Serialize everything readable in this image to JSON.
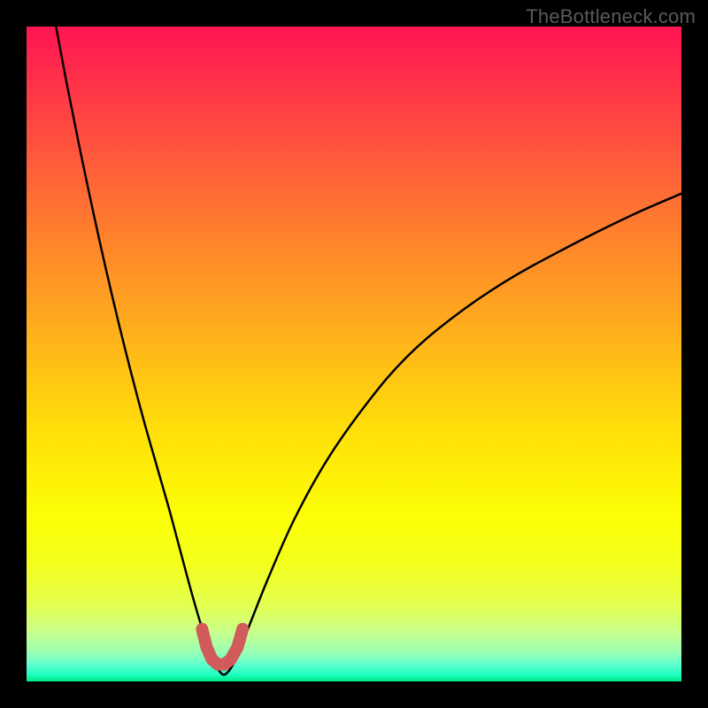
{
  "watermark": "TheBottleneck.com",
  "colors": {
    "page_bg": "#000000",
    "curve_stroke": "#000000",
    "marker_stroke": "#d15a5a"
  },
  "chart_data": {
    "type": "line",
    "title": "",
    "xlabel": "",
    "ylabel": "",
    "xlim": [
      0,
      100
    ],
    "ylim": [
      0,
      100
    ],
    "background_gradient": {
      "direction": "vertical_top_to_bottom",
      "stops": [
        {
          "offset": 0.0,
          "color": "#ff1452"
        },
        {
          "offset": 0.12,
          "color": "#ff3e45"
        },
        {
          "offset": 0.3,
          "color": "#ff7b2f"
        },
        {
          "offset": 0.48,
          "color": "#ffb41a"
        },
        {
          "offset": 0.62,
          "color": "#ffe009"
        },
        {
          "offset": 0.75,
          "color": "#fcff05"
        },
        {
          "offset": 0.82,
          "color": "#f3ff1d"
        },
        {
          "offset": 0.885,
          "color": "#e4ff52"
        },
        {
          "offset": 0.925,
          "color": "#c7ff8c"
        },
        {
          "offset": 0.955,
          "color": "#9affb3"
        },
        {
          "offset": 0.975,
          "color": "#5effcf"
        },
        {
          "offset": 0.99,
          "color": "#1bffbf"
        },
        {
          "offset": 1.0,
          "color": "#00e885"
        }
      ]
    },
    "series": [
      {
        "name": "bottleneck-curve",
        "x": [
          4.5,
          6,
          8,
          10,
          12,
          14,
          16,
          18,
          20,
          22,
          24,
          25.5,
          27,
          28.5,
          29.5,
          30.5,
          32,
          34,
          37,
          41,
          46,
          52,
          58,
          65,
          73,
          82,
          92,
          100
        ],
        "y": [
          100,
          92,
          82,
          72.5,
          63.5,
          55,
          47,
          39.5,
          32.5,
          25.5,
          18,
          12.5,
          7.5,
          3.5,
          1.5,
          1.2,
          3.5,
          8.5,
          16,
          25,
          34,
          42.5,
          49.5,
          55.5,
          61,
          66,
          71,
          74.5
        ]
      }
    ],
    "marker": {
      "name": "optimal-zone",
      "color": "#d15a5a",
      "stroke_width_px": 14,
      "points_x": [
        26.8,
        27.5,
        28.3,
        29.2,
        30.2,
        31.2,
        32.2,
        33.0
      ],
      "points_y": [
        8.0,
        5.2,
        3.4,
        2.6,
        2.6,
        3.4,
        5.2,
        8.0
      ]
    }
  }
}
